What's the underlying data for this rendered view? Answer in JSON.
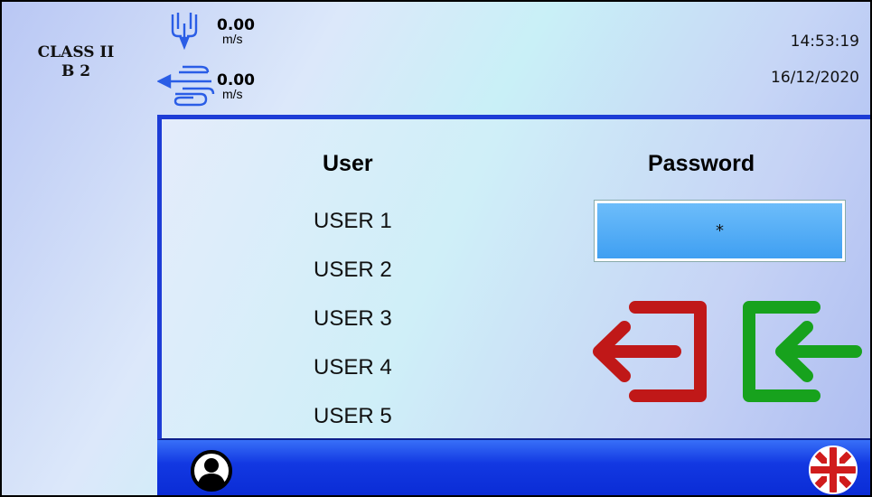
{
  "header": {
    "class_line1": "CLASS II",
    "class_line2": "B 2",
    "downflow": {
      "value": "0.00",
      "unit": "m/s",
      "icon": "downflow-icon"
    },
    "inflow": {
      "value": "0.00",
      "unit": "m/s",
      "icon": "inflow-icon"
    },
    "time": "14:53:19",
    "date": "16/12/2020"
  },
  "login": {
    "user_title": "User",
    "password_title": "Password",
    "users": [
      "USER 1",
      "USER 2",
      "USER 3",
      "USER 4",
      "USER 5"
    ],
    "password_value": "*",
    "logout_icon": "logout-icon",
    "login_icon": "login-icon"
  },
  "bottom": {
    "user_icon": "user-profile-icon",
    "language_icon": "uk-flag-icon"
  },
  "colors": {
    "header_accent": "#1d3cd6",
    "logout_red": "#c01818",
    "login_green": "#17a21d",
    "password_field": "#4aa8f5"
  }
}
